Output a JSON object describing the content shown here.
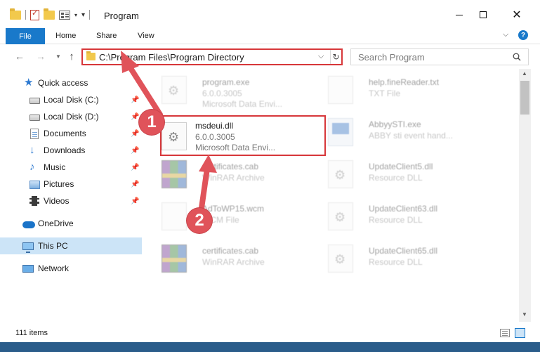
{
  "window": {
    "title": "Program"
  },
  "ribbon": {
    "file": "File",
    "home": "Home",
    "share": "Share",
    "view": "View"
  },
  "address": {
    "path": "C:\\Program Files\\Program Directory"
  },
  "search": {
    "placeholder": "Search Program"
  },
  "sidebar": {
    "quick_access": "Quick access",
    "local_c": "Local Disk (C:)",
    "local_d": "Local Disk (D:)",
    "documents": "Documents",
    "downloads": "Downloads",
    "music": "Music",
    "pictures": "Pictures",
    "videos": "Videos",
    "onedrive": "OneDrive",
    "this_pc": "This PC",
    "network": "Network"
  },
  "files": [
    {
      "name": "program.exe",
      "line1": "6.0.0.3005",
      "line2": "Microsoft Data Envi..."
    },
    {
      "name": "help.fineReader.txt",
      "line1": "TXT File",
      "line2": ""
    },
    {
      "name": "msdeui.dll",
      "line1": "6.0.0.3005",
      "line2": "Microsoft Data Envi..."
    },
    {
      "name": "AbbyySTI.exe",
      "line1": "ABBY sti event hand...",
      "line2": ""
    },
    {
      "name": "certificates.cab",
      "line1": "WinRAR Archive",
      "line2": ""
    },
    {
      "name": "UpdateClient5.dll",
      "line1": "Resource DLL",
      "line2": ""
    },
    {
      "name": "AdToWP15.wcm",
      "line1": "WCM File",
      "line2": ""
    },
    {
      "name": "UpdateClient63.dll",
      "line1": "Resource DLL",
      "line2": ""
    },
    {
      "name": "certificates.cab",
      "line1": "WinRAR Archive",
      "line2": ""
    },
    {
      "name": "UpdateClient65.dll",
      "line1": "Resource DLL",
      "line2": ""
    }
  ],
  "status": {
    "items": "111 items"
  },
  "annotations": {
    "step1": "1",
    "step2": "2"
  },
  "colors": {
    "accent": "#1979ca",
    "highlight": "#d7373a",
    "badge": "#e0535a",
    "selected": "#cce4f7"
  }
}
